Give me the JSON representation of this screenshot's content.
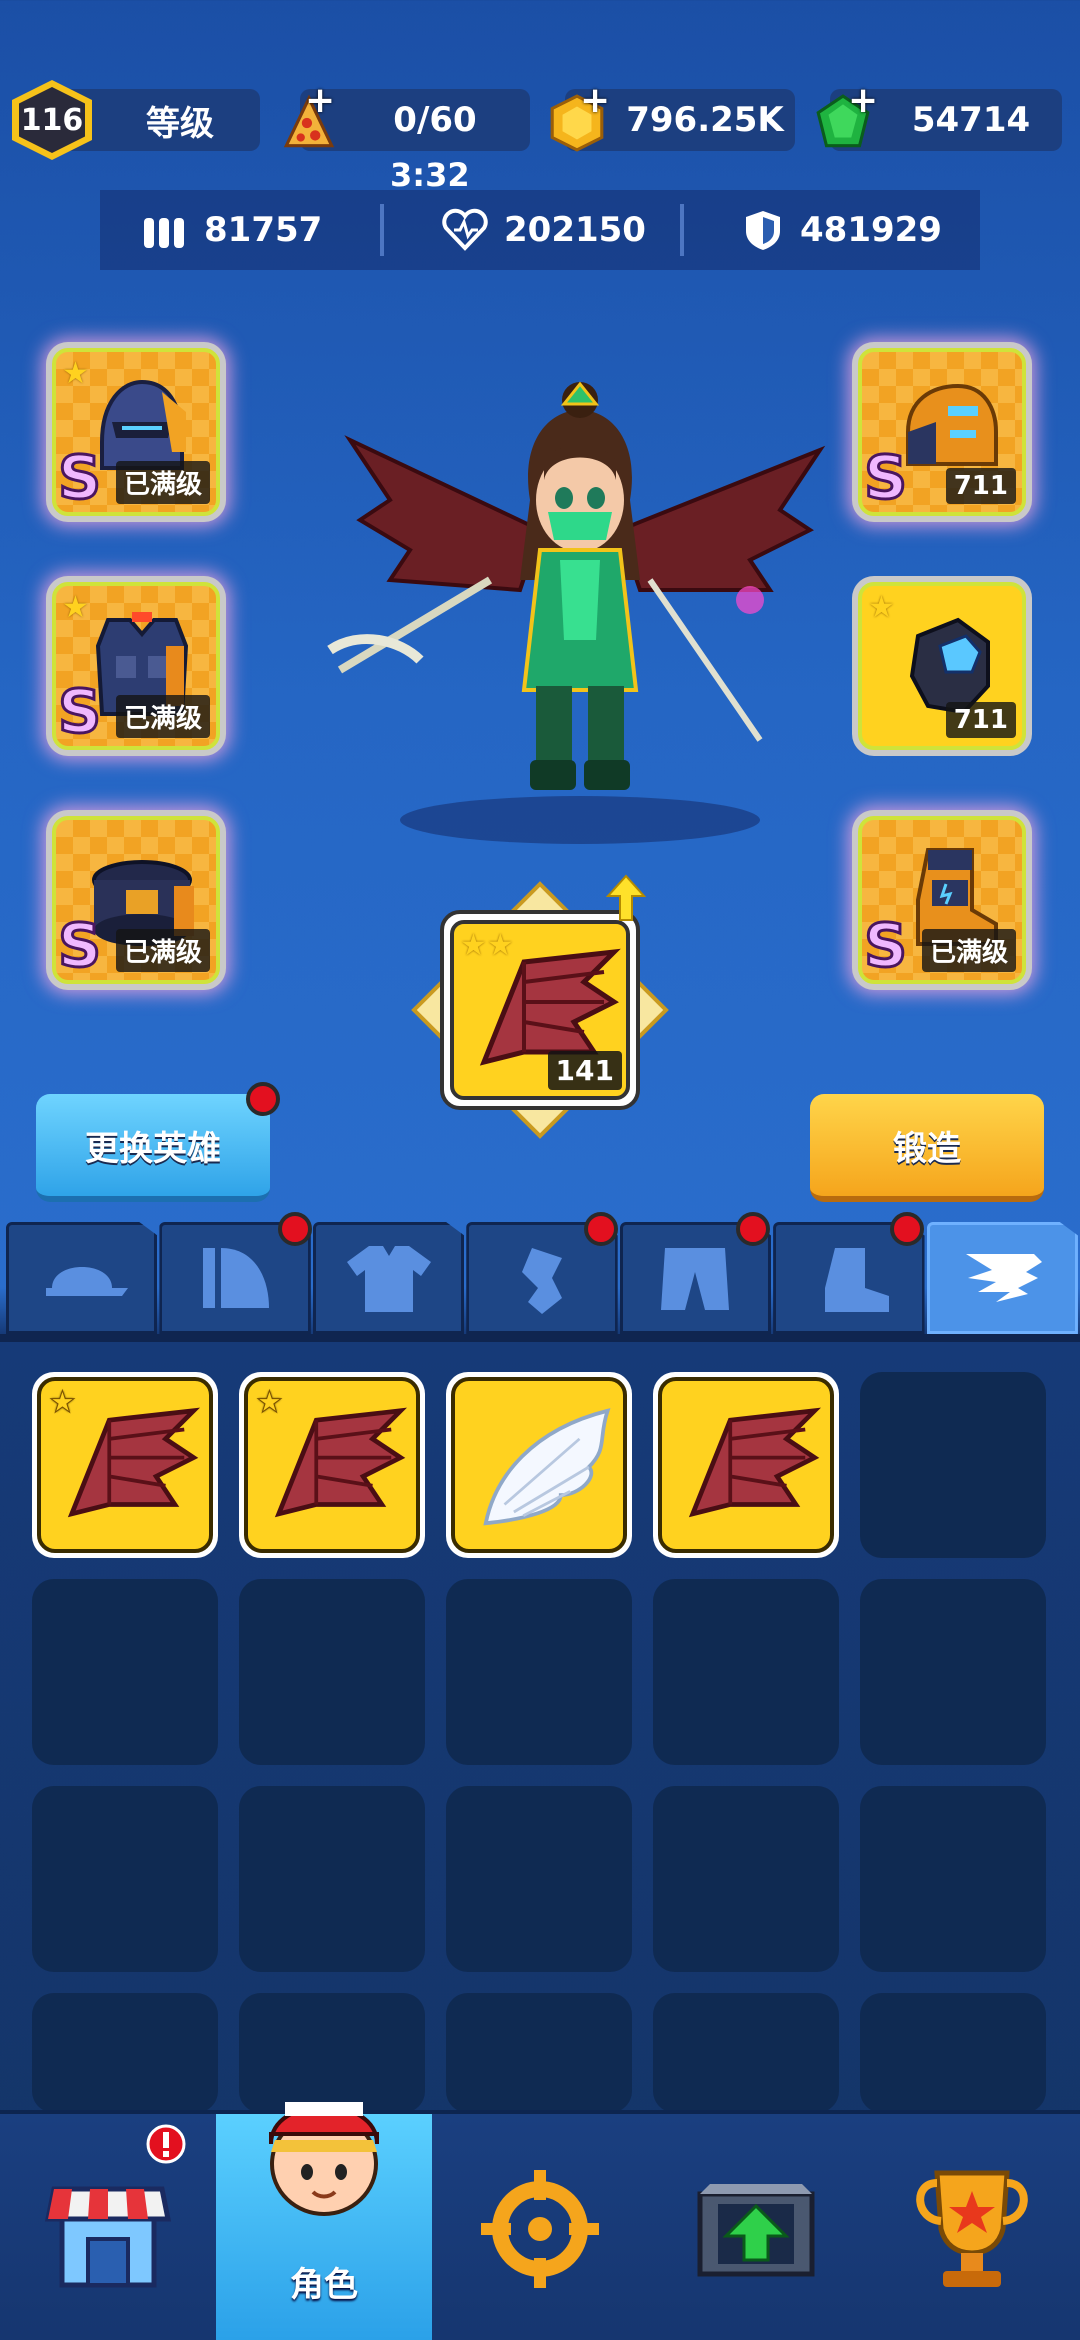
{
  "top_bar": {
    "level": "116",
    "level_label": "等级",
    "energy": "0/60",
    "energy_timer": "3:32",
    "coins": "796.25K",
    "gems": "54714"
  },
  "stats": {
    "ammo": "81757",
    "health": "202150",
    "armor": "481929"
  },
  "equipment": {
    "helmet": {
      "rank": "S",
      "tag": "已满级"
    },
    "vest": {
      "rank": "S",
      "tag": "已满级"
    },
    "belt": {
      "rank": "S",
      "tag": "已满级"
    },
    "shoulder": {
      "rank": "S",
      "tag": "711"
    },
    "glove": {
      "tag": "711"
    },
    "boot": {
      "rank": "S",
      "tag": "已满级"
    },
    "wing": {
      "count": "141"
    }
  },
  "buttons": {
    "change_hero": "更换英雄",
    "forge": "锻造"
  },
  "tabs": [
    "hat",
    "shoulder",
    "shirt",
    "glove",
    "pants",
    "boots",
    "wings"
  ],
  "inventory": [
    {
      "type": "demon-wing",
      "stars": 1
    },
    {
      "type": "demon-wing",
      "stars": 1
    },
    {
      "type": "angel-wing",
      "stars": 0
    },
    {
      "type": "demon-wing",
      "stars": 0
    }
  ],
  "nav": {
    "character_label": "角色"
  },
  "colors": {
    "accent_yellow": "#ffd21f",
    "tab_active": "#4c93e8",
    "notification_red": "#e3101f"
  }
}
